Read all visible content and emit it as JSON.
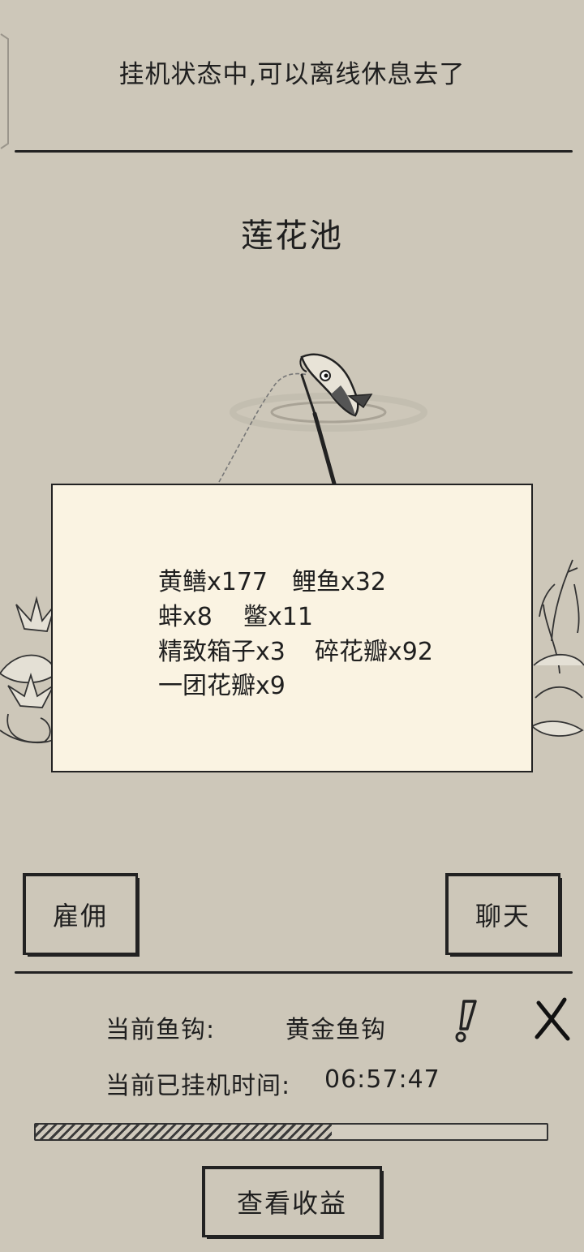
{
  "status": {
    "message": "挂机状态中,可以离线休息去了"
  },
  "location": {
    "name": "莲花池"
  },
  "catch": {
    "rows": [
      [
        "黄鳝x177",
        "鲤鱼x32"
      ],
      [
        "蚌x8",
        "鳖x11"
      ],
      [
        "精致箱子x3",
        "碎花瓣x92"
      ],
      [
        "一团花瓣x9"
      ]
    ]
  },
  "actions": {
    "hire_label": "雇佣",
    "chat_label": "聊天",
    "view_earnings_label": "查看收益"
  },
  "info": {
    "hook_label": "当前鱼钩:",
    "hook_value": "黄金鱼钩",
    "idle_time_label": "当前已挂机时间:",
    "idle_time_value": "06:57:47"
  },
  "progress": {
    "fraction": 0.58
  },
  "icons": {
    "alert": "exclamation-icon",
    "close": "close-icon"
  },
  "colors": {
    "background": "#cdc7b9",
    "panel": "#faf3e2",
    "ink": "#1f1f1f"
  }
}
